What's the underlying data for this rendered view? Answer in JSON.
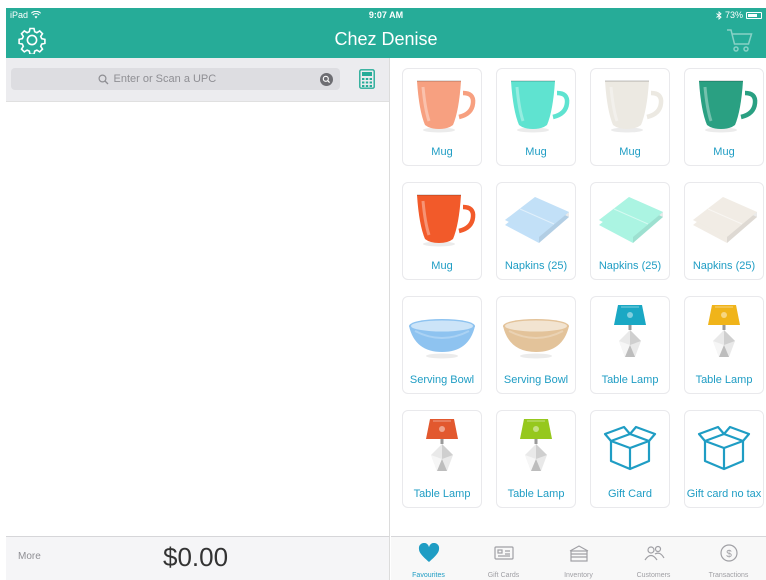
{
  "status_bar": {
    "device": "iPad",
    "time": "9:07 AM",
    "battery": "73%",
    "battery_level": 0.73
  },
  "header": {
    "title": "Chez Denise"
  },
  "search": {
    "placeholder": "Enter or Scan a UPC"
  },
  "products": [
    {
      "label": "Mug",
      "icon": "mug-icon",
      "color": "#f7a080"
    },
    {
      "label": "Mug",
      "icon": "mug-icon",
      "color": "#5fe3d0"
    },
    {
      "label": "Mug",
      "icon": "mug-icon",
      "color": "#ece9e2"
    },
    {
      "label": "Mug",
      "icon": "mug-icon",
      "color": "#2aa082"
    },
    {
      "label": "Mug",
      "icon": "mug-icon",
      "color": "#f25a2a"
    },
    {
      "label": "Napkins (25)",
      "icon": "napkins-icon",
      "color": "#aed6f5"
    },
    {
      "label": "Napkins (25)",
      "icon": "napkins-icon",
      "color": "#8ff0d8"
    },
    {
      "label": "Napkins (25)",
      "icon": "napkins-icon",
      "color": "#ece6dc"
    },
    {
      "label": "Serving Bowl",
      "icon": "bowl-icon",
      "color": "#8ec3f0"
    },
    {
      "label": "Serving Bowl",
      "icon": "bowl-icon",
      "color": "#e3c39a"
    },
    {
      "label": "Table Lamp",
      "icon": "lamp-icon",
      "color": "#1aa8c4"
    },
    {
      "label": "Table Lamp",
      "icon": "lamp-icon",
      "color": "#f0b41a"
    },
    {
      "label": "Table Lamp",
      "icon": "lamp-icon",
      "color": "#e2582e"
    },
    {
      "label": "Table Lamp",
      "icon": "lamp-icon",
      "color": "#96c81e"
    },
    {
      "label": "Gift Card",
      "icon": "gift-box-icon",
      "color": "#1f9dc4"
    },
    {
      "label": "Gift card no tax",
      "icon": "gift-box-icon",
      "color": "#1f9dc4"
    }
  ],
  "footer": {
    "more_label": "More",
    "total": "$0.00"
  },
  "tabs": [
    {
      "label": "Favourites",
      "icon": "heart-icon",
      "active": true
    },
    {
      "label": "Gift Cards",
      "icon": "gift-card-icon",
      "active": false
    },
    {
      "label": "Inventory",
      "icon": "inventory-icon",
      "active": false
    },
    {
      "label": "Customers",
      "icon": "customers-icon",
      "active": false
    },
    {
      "label": "Transactions",
      "icon": "transactions-icon",
      "active": false
    }
  ],
  "colors": {
    "accent": "#26ac98",
    "link": "#1f9dc4",
    "inactive": "#a0a0a5"
  }
}
